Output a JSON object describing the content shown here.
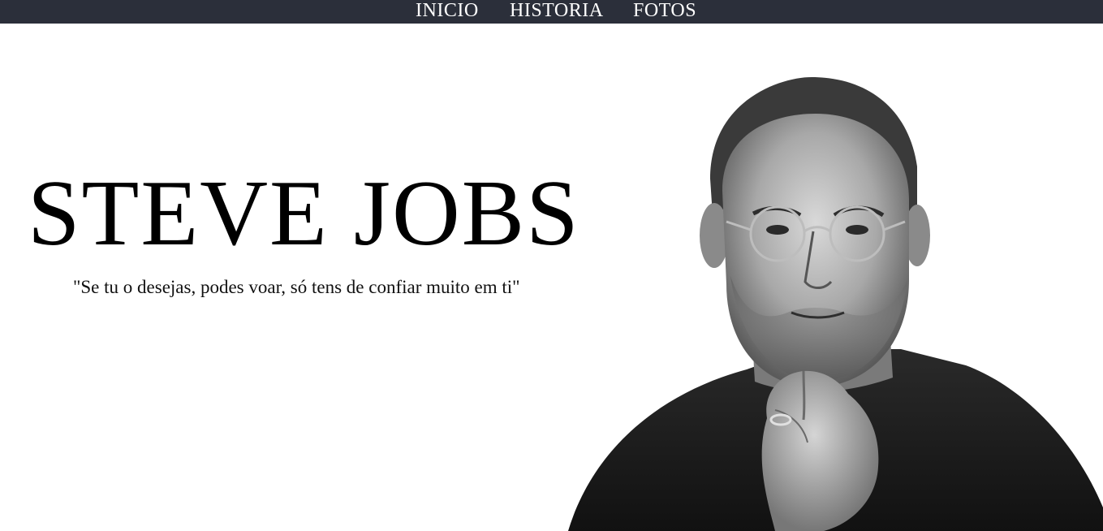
{
  "nav": {
    "items": [
      {
        "label": "INICIO"
      },
      {
        "label": "HISTORIA"
      },
      {
        "label": "FOTOS"
      }
    ]
  },
  "hero": {
    "title": "STEVE JOBS",
    "quote": "\"Se tu o desejas, podes voar, só tens de confiar muito em ti\""
  },
  "portrait": {
    "icon": "portrait-photo",
    "style": "black-and-white"
  },
  "colors": {
    "navbar_bg": "#2b2f3a",
    "nav_text": "#ffffff",
    "page_bg": "#ffffff",
    "title_text": "#000000"
  }
}
